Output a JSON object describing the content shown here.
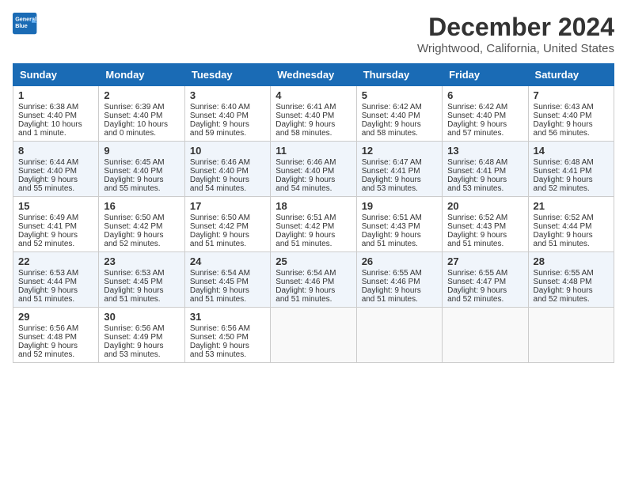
{
  "header": {
    "logo_line1": "General",
    "logo_line2": "Blue",
    "title": "December 2024",
    "subtitle": "Wrightwood, California, United States"
  },
  "columns": [
    "Sunday",
    "Monday",
    "Tuesday",
    "Wednesday",
    "Thursday",
    "Friday",
    "Saturday"
  ],
  "weeks": [
    [
      {
        "day": "1",
        "lines": [
          "Sunrise: 6:38 AM",
          "Sunset: 4:40 PM",
          "Daylight: 10 hours",
          "and 1 minute."
        ]
      },
      {
        "day": "2",
        "lines": [
          "Sunrise: 6:39 AM",
          "Sunset: 4:40 PM",
          "Daylight: 10 hours",
          "and 0 minutes."
        ]
      },
      {
        "day": "3",
        "lines": [
          "Sunrise: 6:40 AM",
          "Sunset: 4:40 PM",
          "Daylight: 9 hours",
          "and 59 minutes."
        ]
      },
      {
        "day": "4",
        "lines": [
          "Sunrise: 6:41 AM",
          "Sunset: 4:40 PM",
          "Daylight: 9 hours",
          "and 58 minutes."
        ]
      },
      {
        "day": "5",
        "lines": [
          "Sunrise: 6:42 AM",
          "Sunset: 4:40 PM",
          "Daylight: 9 hours",
          "and 58 minutes."
        ]
      },
      {
        "day": "6",
        "lines": [
          "Sunrise: 6:42 AM",
          "Sunset: 4:40 PM",
          "Daylight: 9 hours",
          "and 57 minutes."
        ]
      },
      {
        "day": "7",
        "lines": [
          "Sunrise: 6:43 AM",
          "Sunset: 4:40 PM",
          "Daylight: 9 hours",
          "and 56 minutes."
        ]
      }
    ],
    [
      {
        "day": "8",
        "lines": [
          "Sunrise: 6:44 AM",
          "Sunset: 4:40 PM",
          "Daylight: 9 hours",
          "and 55 minutes."
        ]
      },
      {
        "day": "9",
        "lines": [
          "Sunrise: 6:45 AM",
          "Sunset: 4:40 PM",
          "Daylight: 9 hours",
          "and 55 minutes."
        ]
      },
      {
        "day": "10",
        "lines": [
          "Sunrise: 6:46 AM",
          "Sunset: 4:40 PM",
          "Daylight: 9 hours",
          "and 54 minutes."
        ]
      },
      {
        "day": "11",
        "lines": [
          "Sunrise: 6:46 AM",
          "Sunset: 4:40 PM",
          "Daylight: 9 hours",
          "and 54 minutes."
        ]
      },
      {
        "day": "12",
        "lines": [
          "Sunrise: 6:47 AM",
          "Sunset: 4:41 PM",
          "Daylight: 9 hours",
          "and 53 minutes."
        ]
      },
      {
        "day": "13",
        "lines": [
          "Sunrise: 6:48 AM",
          "Sunset: 4:41 PM",
          "Daylight: 9 hours",
          "and 53 minutes."
        ]
      },
      {
        "day": "14",
        "lines": [
          "Sunrise: 6:48 AM",
          "Sunset: 4:41 PM",
          "Daylight: 9 hours",
          "and 52 minutes."
        ]
      }
    ],
    [
      {
        "day": "15",
        "lines": [
          "Sunrise: 6:49 AM",
          "Sunset: 4:41 PM",
          "Daylight: 9 hours",
          "and 52 minutes."
        ]
      },
      {
        "day": "16",
        "lines": [
          "Sunrise: 6:50 AM",
          "Sunset: 4:42 PM",
          "Daylight: 9 hours",
          "and 52 minutes."
        ]
      },
      {
        "day": "17",
        "lines": [
          "Sunrise: 6:50 AM",
          "Sunset: 4:42 PM",
          "Daylight: 9 hours",
          "and 51 minutes."
        ]
      },
      {
        "day": "18",
        "lines": [
          "Sunrise: 6:51 AM",
          "Sunset: 4:42 PM",
          "Daylight: 9 hours",
          "and 51 minutes."
        ]
      },
      {
        "day": "19",
        "lines": [
          "Sunrise: 6:51 AM",
          "Sunset: 4:43 PM",
          "Daylight: 9 hours",
          "and 51 minutes."
        ]
      },
      {
        "day": "20",
        "lines": [
          "Sunrise: 6:52 AM",
          "Sunset: 4:43 PM",
          "Daylight: 9 hours",
          "and 51 minutes."
        ]
      },
      {
        "day": "21",
        "lines": [
          "Sunrise: 6:52 AM",
          "Sunset: 4:44 PM",
          "Daylight: 9 hours",
          "and 51 minutes."
        ]
      }
    ],
    [
      {
        "day": "22",
        "lines": [
          "Sunrise: 6:53 AM",
          "Sunset: 4:44 PM",
          "Daylight: 9 hours",
          "and 51 minutes."
        ]
      },
      {
        "day": "23",
        "lines": [
          "Sunrise: 6:53 AM",
          "Sunset: 4:45 PM",
          "Daylight: 9 hours",
          "and 51 minutes."
        ]
      },
      {
        "day": "24",
        "lines": [
          "Sunrise: 6:54 AM",
          "Sunset: 4:45 PM",
          "Daylight: 9 hours",
          "and 51 minutes."
        ]
      },
      {
        "day": "25",
        "lines": [
          "Sunrise: 6:54 AM",
          "Sunset: 4:46 PM",
          "Daylight: 9 hours",
          "and 51 minutes."
        ]
      },
      {
        "day": "26",
        "lines": [
          "Sunrise: 6:55 AM",
          "Sunset: 4:46 PM",
          "Daylight: 9 hours",
          "and 51 minutes."
        ]
      },
      {
        "day": "27",
        "lines": [
          "Sunrise: 6:55 AM",
          "Sunset: 4:47 PM",
          "Daylight: 9 hours",
          "and 52 minutes."
        ]
      },
      {
        "day": "28",
        "lines": [
          "Sunrise: 6:55 AM",
          "Sunset: 4:48 PM",
          "Daylight: 9 hours",
          "and 52 minutes."
        ]
      }
    ],
    [
      {
        "day": "29",
        "lines": [
          "Sunrise: 6:56 AM",
          "Sunset: 4:48 PM",
          "Daylight: 9 hours",
          "and 52 minutes."
        ]
      },
      {
        "day": "30",
        "lines": [
          "Sunrise: 6:56 AM",
          "Sunset: 4:49 PM",
          "Daylight: 9 hours",
          "and 53 minutes."
        ]
      },
      {
        "day": "31",
        "lines": [
          "Sunrise: 6:56 AM",
          "Sunset: 4:50 PM",
          "Daylight: 9 hours",
          "and 53 minutes."
        ]
      },
      {
        "day": "",
        "lines": []
      },
      {
        "day": "",
        "lines": []
      },
      {
        "day": "",
        "lines": []
      },
      {
        "day": "",
        "lines": []
      }
    ]
  ]
}
